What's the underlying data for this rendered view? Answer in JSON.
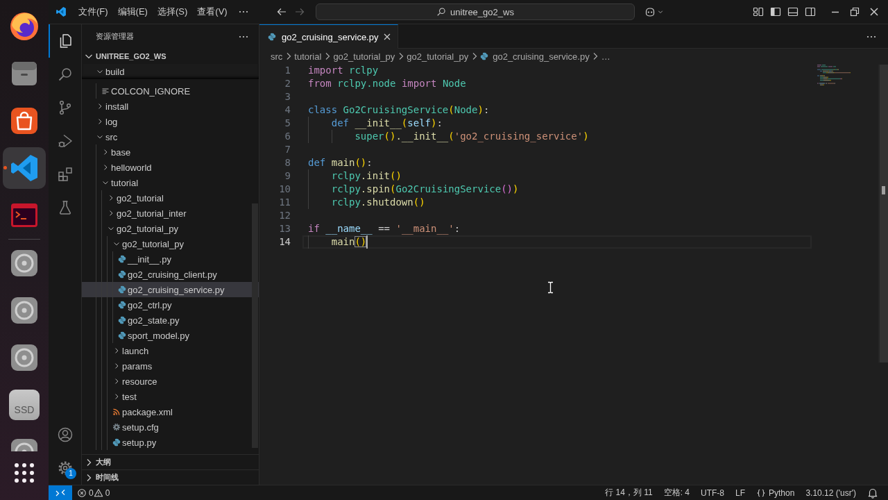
{
  "dock": {
    "apps": [
      {
        "kind": "browser",
        "active": false
      },
      {
        "kind": "files",
        "active": false
      },
      {
        "kind": "store",
        "active": false
      },
      {
        "kind": "editor",
        "active": true
      },
      {
        "kind": "terminal",
        "active": false
      }
    ],
    "drives": [
      {
        "kind": "disk"
      },
      {
        "kind": "disk"
      },
      {
        "kind": "disk"
      },
      {
        "kind": "ssd",
        "label": "SSD"
      },
      {
        "kind": "disk"
      }
    ]
  },
  "title_bar": {
    "menus": [
      "文件(F)",
      "编辑(E)",
      "选择(S)",
      "查看(V)"
    ],
    "navigation": [
      {
        "kind": "back",
        "disabled": false
      },
      {
        "kind": "forward",
        "disabled": true
      }
    ],
    "command_center": "unitree_go2_ws",
    "layout_toggles": [
      {
        "kind": "sidebar",
        "on": true
      },
      {
        "kind": "panel",
        "on": false
      },
      {
        "kind": "secondary",
        "on": false
      }
    ]
  },
  "activity_bar": {
    "items": [
      {
        "kind": "explorer",
        "selected": true
      },
      {
        "kind": "search",
        "selected": false
      },
      {
        "kind": "scm",
        "selected": false
      },
      {
        "kind": "debug",
        "selected": false
      },
      {
        "kind": "extensions",
        "selected": false
      },
      {
        "kind": "testing",
        "selected": false
      }
    ],
    "settings_badge": "1"
  },
  "sidebar": {
    "title": "资源管理器",
    "workspace": {
      "label": "UNITREE_GO2_WS",
      "expanded": true
    },
    "tree": [
      {
        "label": "build",
        "kind": "folder",
        "expanded": true,
        "selected": false,
        "sticky": true,
        "children": [
          {
            "label": "COLCON_IGNORE",
            "kind": "text",
            "selected": false
          }
        ]
      },
      {
        "label": "install",
        "kind": "folder",
        "expanded": false,
        "selected": false
      },
      {
        "label": "log",
        "kind": "folder",
        "expanded": false,
        "selected": false
      },
      {
        "label": "src",
        "kind": "folder",
        "expanded": true,
        "selected": false,
        "children": [
          {
            "label": "base",
            "kind": "folder",
            "expanded": false,
            "selected": false
          },
          {
            "label": "helloworld",
            "kind": "folder",
            "expanded": false,
            "selected": false
          },
          {
            "label": "tutorial",
            "kind": "folder",
            "expanded": true,
            "selected": false,
            "children": [
              {
                "label": "go2_tutorial",
                "kind": "folder",
                "expanded": false,
                "selected": false
              },
              {
                "label": "go2_tutorial_inter",
                "kind": "folder",
                "expanded": false,
                "selected": false
              },
              {
                "label": "go2_tutorial_py",
                "kind": "folder",
                "expanded": true,
                "selected": false,
                "children": [
                  {
                    "label": "go2_tutorial_py",
                    "kind": "folder",
                    "expanded": true,
                    "selected": false,
                    "children": [
                      {
                        "label": "__init__.py",
                        "kind": "python",
                        "selected": false
                      },
                      {
                        "label": "go2_cruising_client.py",
                        "kind": "python",
                        "selected": false
                      },
                      {
                        "label": "go2_cruising_service.py",
                        "kind": "python",
                        "selected": true
                      },
                      {
                        "label": "go2_ctrl.py",
                        "kind": "python",
                        "selected": false
                      },
                      {
                        "label": "go2_state.py",
                        "kind": "python",
                        "selected": false
                      },
                      {
                        "label": "sport_model.py",
                        "kind": "python",
                        "selected": false
                      }
                    ]
                  },
                  {
                    "label": "launch",
                    "kind": "folder",
                    "expanded": false,
                    "selected": false
                  },
                  {
                    "label": "params",
                    "kind": "folder",
                    "expanded": false,
                    "selected": false
                  },
                  {
                    "label": "resource",
                    "kind": "folder",
                    "expanded": false,
                    "selected": false
                  },
                  {
                    "label": "test",
                    "kind": "folder",
                    "expanded": false,
                    "selected": false
                  },
                  {
                    "label": "package.xml",
                    "kind": "xml",
                    "selected": false
                  },
                  {
                    "label": "setup.cfg",
                    "kind": "config",
                    "selected": false
                  },
                  {
                    "label": "setup.py",
                    "kind": "python",
                    "selected": false
                  }
                ]
              }
            ]
          }
        ]
      }
    ],
    "sections": [
      {
        "label": "大纲",
        "expanded": false
      },
      {
        "label": "时间线",
        "expanded": false
      }
    ]
  },
  "editor": {
    "tabs": [
      {
        "label": "go2_cruising_service.py",
        "kind": "python",
        "selected": true
      }
    ],
    "breadcrumbs": [
      {
        "label": "src",
        "kind": "folder"
      },
      {
        "label": "tutorial",
        "kind": "folder"
      },
      {
        "label": "go2_tutorial_py",
        "kind": "folder"
      },
      {
        "label": "go2_tutorial_py",
        "kind": "folder"
      },
      {
        "label": "go2_cruising_service.py",
        "kind": "python"
      },
      {
        "label": "…",
        "kind": "more"
      }
    ],
    "lines": [
      {
        "number": "1",
        "current": false,
        "tokens": [
          {
            "kind": "keyword",
            "text": "import "
          },
          {
            "kind": "type",
            "text": "rclpy"
          }
        ]
      },
      {
        "number": "2",
        "current": false,
        "tokens": [
          {
            "kind": "keyword",
            "text": "from "
          },
          {
            "kind": "type",
            "text": "rclpy.node "
          },
          {
            "kind": "keyword",
            "text": "import "
          },
          {
            "kind": "type",
            "text": "Node"
          }
        ]
      },
      {
        "number": "3",
        "current": false
      },
      {
        "number": "4",
        "current": false,
        "tokens": [
          {
            "kind": "storage",
            "text": "class "
          },
          {
            "kind": "type",
            "text": "Go2CruisingService"
          },
          {
            "kind": "bracket1",
            "text": "("
          },
          {
            "kind": "type",
            "text": "Node"
          },
          {
            "kind": "bracket1",
            "text": ")"
          },
          {
            "kind": "plain",
            "text": ":"
          }
        ],
        "children": [
          {
            "number": "5",
            "current": false,
            "tokens": [
              {
                "kind": "storage",
                "text": "def "
              },
              {
                "kind": "function",
                "text": "__init__"
              },
              {
                "kind": "bracket1",
                "text": "("
              },
              {
                "kind": "variable",
                "text": "self"
              },
              {
                "kind": "bracket1",
                "text": ")"
              },
              {
                "kind": "plain",
                "text": ":"
              }
            ],
            "children": [
              {
                "number": "6",
                "current": false,
                "tokens": [
                  {
                    "kind": "type",
                    "text": "super"
                  },
                  {
                    "kind": "bracket1",
                    "text": "()"
                  },
                  {
                    "kind": "function",
                    "text": ".__init__"
                  },
                  {
                    "kind": "bracket1",
                    "text": "("
                  },
                  {
                    "kind": "string",
                    "text": "'go2_cruising_service'"
                  },
                  {
                    "kind": "bracket1",
                    "text": ")"
                  }
                ]
              }
            ]
          }
        ]
      },
      {
        "number": "7",
        "current": false
      },
      {
        "number": "8",
        "current": false,
        "tokens": [
          {
            "kind": "storage",
            "text": "def "
          },
          {
            "kind": "function",
            "text": "main"
          },
          {
            "kind": "bracket1",
            "text": "()"
          },
          {
            "kind": "plain",
            "text": ":"
          }
        ],
        "children": [
          {
            "number": "9",
            "current": false,
            "tokens": [
              {
                "kind": "type",
                "text": "rclpy"
              },
              {
                "kind": "function",
                "text": ".init"
              },
              {
                "kind": "bracket1",
                "text": "()"
              }
            ]
          },
          {
            "number": "10",
            "current": false,
            "tokens": [
              {
                "kind": "type",
                "text": "rclpy"
              },
              {
                "kind": "function",
                "text": ".spin"
              },
              {
                "kind": "bracket1",
                "text": "("
              },
              {
                "kind": "type",
                "text": "Go2CruisingService"
              },
              {
                "kind": "bracket2",
                "text": "()"
              },
              {
                "kind": "bracket1",
                "text": ")"
              }
            ]
          },
          {
            "number": "11",
            "current": false,
            "tokens": [
              {
                "kind": "type",
                "text": "rclpy"
              },
              {
                "kind": "function",
                "text": ".shutdown"
              },
              {
                "kind": "bracket1",
                "text": "()"
              }
            ]
          }
        ]
      },
      {
        "number": "12",
        "current": false
      },
      {
        "number": "13",
        "current": false,
        "tokens": [
          {
            "kind": "keyword",
            "text": "if "
          },
          {
            "kind": "variable",
            "text": "__name__"
          },
          {
            "kind": "plain",
            "text": " == "
          },
          {
            "kind": "string",
            "text": "'__main__'"
          },
          {
            "kind": "plain",
            "text": ":"
          }
        ],
        "children": [
          {
            "number": "14",
            "current": true,
            "tokens": [
              {
                "kind": "function",
                "text": "main"
              },
              {
                "kind": "match",
                "text": "()"
              }
            ]
          }
        ]
      }
    ]
  },
  "status_bar": {
    "problems": {
      "errors": "0",
      "warnings": "0"
    },
    "items": [
      "行 14，列 11",
      "空格: 4",
      "UTF-8",
      "LF"
    ],
    "language": "Python",
    "interpreter": "3.10.12 ('usr')"
  }
}
